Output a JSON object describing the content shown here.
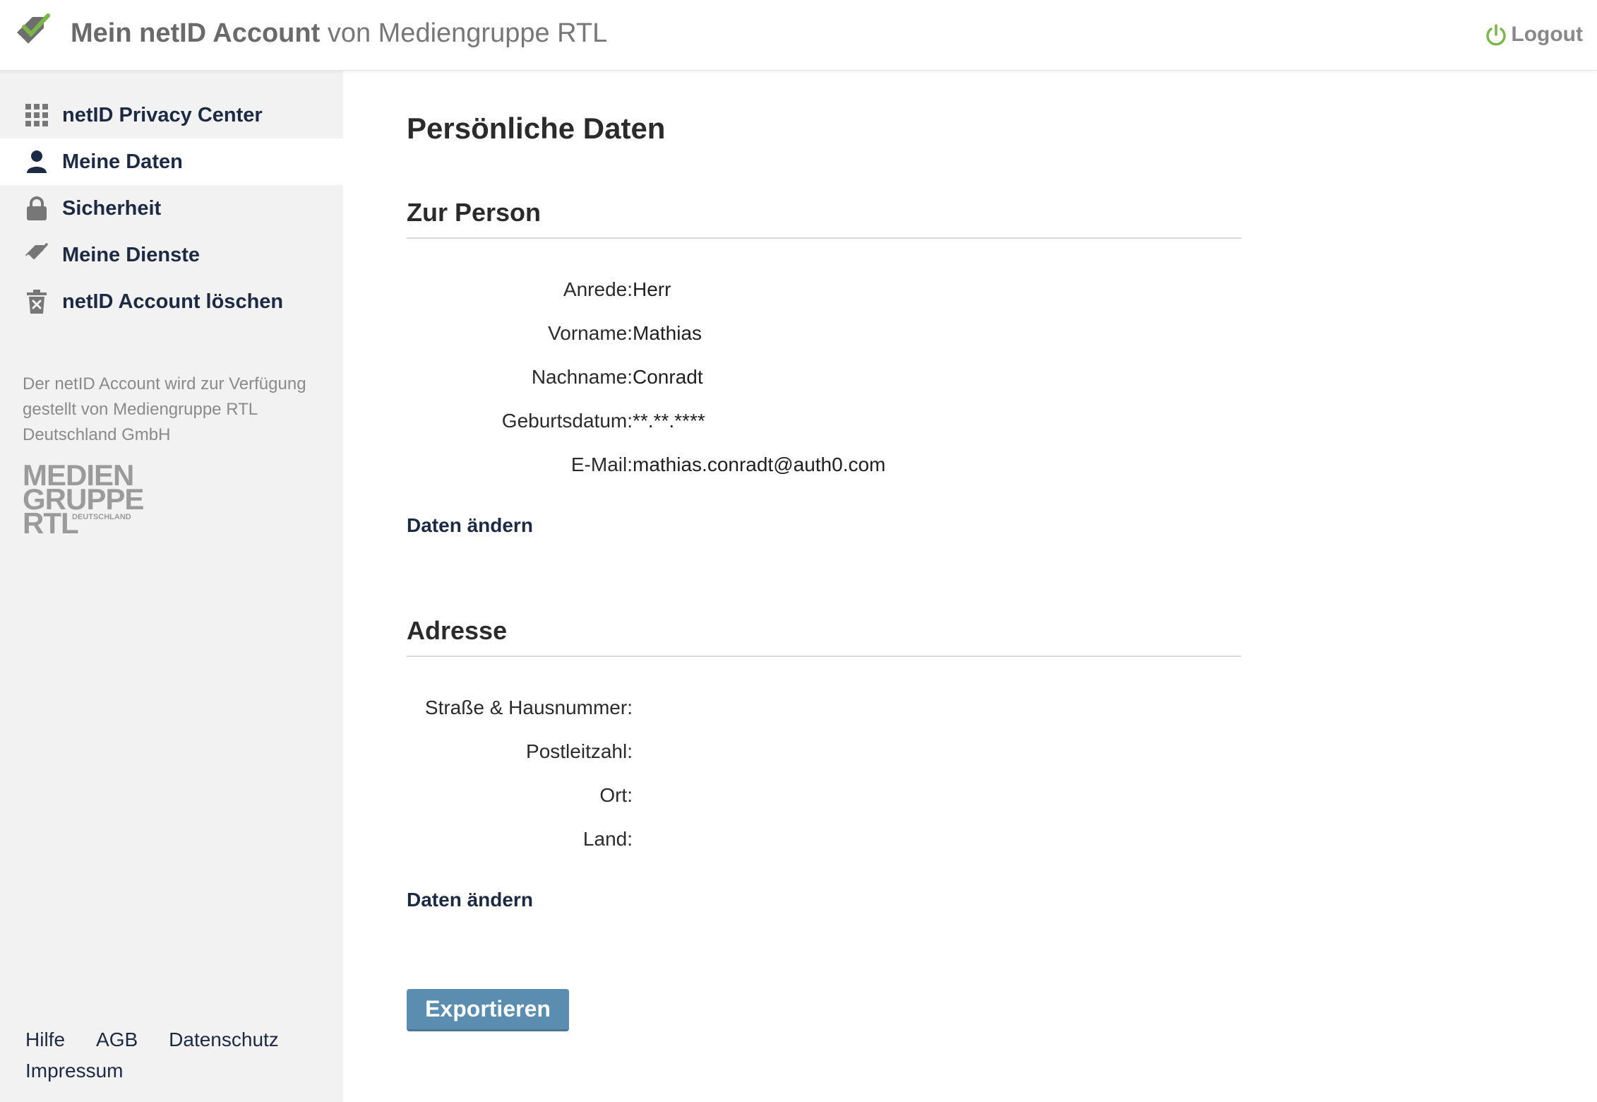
{
  "header": {
    "title_strong": "Mein netID Account",
    "title_rest": "von Mediengruppe RTL",
    "logout_label": "Logout",
    "logo_icon": "netid-check-icon",
    "colors": {
      "accent_green": "#7ab648",
      "logo_grey": "#6e6e6e"
    }
  },
  "sidebar": {
    "items": [
      {
        "label": "netID Privacy Center",
        "icon": "grid-icon",
        "active": false
      },
      {
        "label": "Meine Daten",
        "icon": "user-icon",
        "active": true
      },
      {
        "label": "Sicherheit",
        "icon": "lock-icon",
        "active": false
      },
      {
        "label": "Meine Dienste",
        "icon": "services-check-icon",
        "active": false
      },
      {
        "label": "netID Account löschen",
        "icon": "trash-icon",
        "active": false
      }
    ],
    "provider_text": "Der netID Account wird zur Verfügung gestellt von Mediengruppe RTL Deutschland GmbH",
    "provider_logo": {
      "line1": "MEDIEN",
      "line2": "GRUPPE",
      "line3": "RTL",
      "sub": "DEUTSCHLAND"
    },
    "footer_links": [
      "Hilfe",
      "AGB",
      "Datenschutz",
      "Impressum"
    ]
  },
  "main": {
    "page_title": "Persönliche Daten",
    "person_section": {
      "title": "Zur Person",
      "fields": [
        {
          "label": "Anrede:",
          "value": "Herr"
        },
        {
          "label": "Vorname:",
          "value": "Mathias"
        },
        {
          "label": "Nachname:",
          "value": "Conradt"
        },
        {
          "label": "Geburtsdatum:",
          "value": "**.**.****"
        },
        {
          "label": "E-Mail:",
          "value": "mathias.conradt@auth0.com"
        }
      ],
      "edit_label": "Daten ändern"
    },
    "address_section": {
      "title": "Adresse",
      "fields": [
        {
          "label": "Straße & Hausnummer:",
          "value": ""
        },
        {
          "label": "Postleitzahl:",
          "value": ""
        },
        {
          "label": "Ort:",
          "value": ""
        },
        {
          "label": "Land:",
          "value": ""
        }
      ],
      "edit_label": "Daten ändern"
    },
    "export_label": "Exportieren",
    "colors": {
      "export_button": "#5b8db0",
      "nav_text": "#1d2a44"
    }
  }
}
